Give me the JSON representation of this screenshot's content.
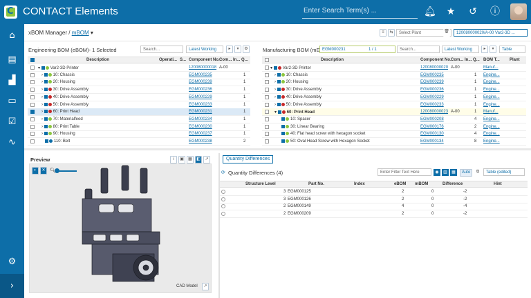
{
  "app": {
    "title": "CONTACT Elements"
  },
  "search": {
    "placeholder": "Enter Search Term(s) ..."
  },
  "breadcrumb": {
    "root": "xBOM Manager",
    "current": "mBOM"
  },
  "header": {
    "plant_placeholder": "Select Plant",
    "mbom_selector": "120080000020/A-00 Var2-3D ..."
  },
  "ebom": {
    "title": "Engineering BOM (eBOM)- 1 Selected",
    "search_placeholder": "Search...",
    "view_label": "Latest Working",
    "columns": [
      "Description",
      "Operati...",
      "S...",
      "Component No.",
      "Com...",
      "In...",
      "Q..."
    ],
    "rows": [
      {
        "desc": "Var2-3D Printer",
        "component": "120080000018",
        "com": "A-00",
        "qty": ""
      },
      {
        "desc": "10: Chassis",
        "component": "EGM000235",
        "com": "",
        "qty": "1"
      },
      {
        "desc": "20: Housing",
        "component": "EGM000239",
        "com": "",
        "qty": "1"
      },
      {
        "desc": "30: Drive Assembly",
        "component": "EGM000236",
        "com": "",
        "qty": "1"
      },
      {
        "desc": "40: Drive Assembly",
        "component": "EGM000229",
        "com": "",
        "qty": "1"
      },
      {
        "desc": "50: Drive Assembly",
        "component": "EGM000233",
        "com": "",
        "qty": "1"
      },
      {
        "desc": "60: Print Head",
        "component": "EGM000231",
        "com": "",
        "qty": "1"
      },
      {
        "desc": "70: Materialfeed",
        "component": "EGM000234",
        "com": "",
        "qty": "1"
      },
      {
        "desc": "80: Print Table",
        "component": "EGM000230",
        "com": "",
        "qty": "1"
      },
      {
        "desc": "90: Housing",
        "component": "EGM000237",
        "com": "",
        "qty": "1"
      },
      {
        "desc": "110: Belt",
        "component": "EGM000238",
        "com": "",
        "qty": "2"
      }
    ]
  },
  "mbom": {
    "title": "Manufacturing BOM (mE",
    "filter_value": "EGM000231",
    "match_count": "1 / 1",
    "search_placeholder": "Search...",
    "view_label": "Latest Working",
    "table_label": "Table",
    "columns": [
      "Description",
      "Component No.",
      "Com...",
      "In...",
      "Q...",
      "BOM T...",
      "Plant"
    ],
    "rows": [
      {
        "desc": "Var2-3D Printer",
        "component": "120080000020",
        "com": "A-00",
        "qty": "",
        "bom": "Manuf..."
      },
      {
        "desc": "10: Chassis",
        "component": "EGM000235",
        "com": "",
        "qty": "1",
        "bom": "Engine..."
      },
      {
        "desc": "20: Housing",
        "component": "EGM000239",
        "com": "",
        "qty": "1",
        "bom": "Engine..."
      },
      {
        "desc": "30: Drive Assembly",
        "component": "EGM000236",
        "com": "",
        "qty": "1",
        "bom": "Engine..."
      },
      {
        "desc": "40: Drive Assembly",
        "component": "EGM000229",
        "com": "",
        "qty": "1",
        "bom": "Engine..."
      },
      {
        "desc": "50: Drive Assembly",
        "component": "EGM000233",
        "com": "",
        "qty": "1",
        "bom": "Engine..."
      },
      {
        "desc": "60: Print Head",
        "component": "120080000023",
        "com": "A-00",
        "qty": "1",
        "bom": "Manuf..."
      },
      {
        "desc": "10: Spacer",
        "component": "EGM000208",
        "com": "",
        "qty": "4",
        "bom": "Engine..."
      },
      {
        "desc": "30: Linear Bearing",
        "component": "EGM000176",
        "com": "",
        "qty": "2",
        "bom": "Engine..."
      },
      {
        "desc": "40: Flat head screw with hexagon socket",
        "component": "EGM000130",
        "com": "",
        "qty": "4",
        "bom": "Engine..."
      },
      {
        "desc": "50: Oval Head Screw with Hexagon Socket",
        "component": "EGM000134",
        "com": "",
        "qty": "8",
        "bom": "Engine..."
      }
    ]
  },
  "preview": {
    "title": "Preview",
    "cad_label": "CAD Model"
  },
  "quantity": {
    "tab_label": "Quantity Differences",
    "title": "Quantity Differences (4)",
    "filter_placeholder": "Enter Filter Text Here",
    "auto_label": "Auto",
    "table_label": "Table (edited)",
    "columns": [
      "Structure Level",
      "Part No.",
      "Index",
      "eBOM",
      "mBOM",
      "Difference",
      "Hint"
    ],
    "rows": [
      {
        "level": "3",
        "part": "EGM000125",
        "index": "",
        "ebom": "2",
        "mbom": "0",
        "diff": "-2"
      },
      {
        "level": "3",
        "part": "EGM000126",
        "index": "",
        "ebom": "2",
        "mbom": "0",
        "diff": "-2"
      },
      {
        "level": "2",
        "part": "EGM000149",
        "index": "",
        "ebom": "4",
        "mbom": "0",
        "diff": "-4"
      },
      {
        "level": "2",
        "part": "EGM000209",
        "index": "",
        "ebom": "2",
        "mbom": "0",
        "diff": "-2"
      }
    ]
  },
  "colors": {
    "brand": "#0d6ea8",
    "accent_green": "#8cc63f"
  }
}
